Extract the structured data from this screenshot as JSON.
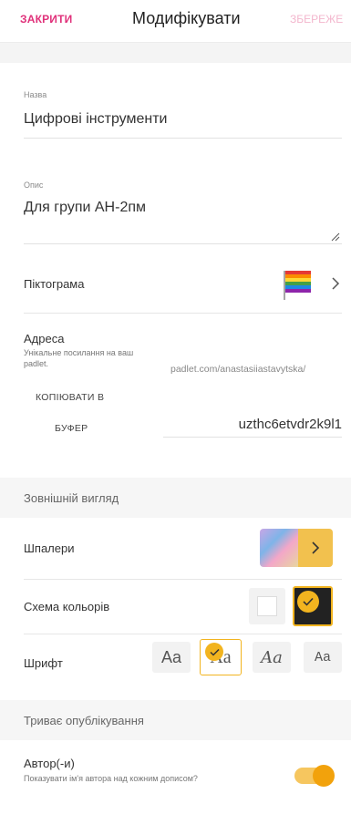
{
  "header": {
    "close_label": "ЗАКРИТИ",
    "title": "Модифікувати",
    "save_label": "ЗБЕРЕЖЕ"
  },
  "name_field": {
    "label": "Назва",
    "value": "Цифрові інструменти"
  },
  "description_field": {
    "label": "Опис",
    "value": "Для групи АН-2пм"
  },
  "icon_row": {
    "label": "Піктограма"
  },
  "address": {
    "label": "Адреса",
    "hint": "Унікальне посилання на ваш padlet.",
    "url_prefix": "padlet.com/anastasiiastavytska/",
    "url_slug": "uzthc6etvdr2k9l1",
    "copy_line1": "КОПІЮВАТИ В",
    "copy_line2": "БУФЕР"
  },
  "appearance": {
    "section_title": "Зовнішній вигляд",
    "wallpaper_label": "Шпалери",
    "color_scheme_label": "Схема кольорів",
    "font_label": "Шрифт",
    "font_options": [
      "Aa",
      "Aa",
      "Aa",
      "Aa"
    ],
    "selected_font_index": 1,
    "selected_color_scheme": "dark"
  },
  "publishing": {
    "section_title": "Триває опублікування",
    "author_label": "Автор(-и)",
    "author_hint": "Показувати ім'я автора над кожним дописом?",
    "author_toggle_on": true
  },
  "colors": {
    "accent": "#e0317a",
    "accent_light": "#f3b6cd",
    "selection": "#f2b41f"
  }
}
